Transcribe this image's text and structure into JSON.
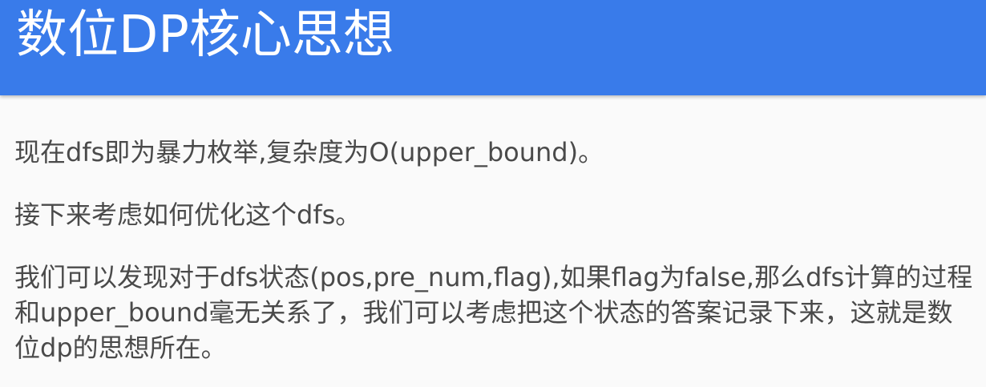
{
  "header": {
    "title": "数位DP核心思想",
    "background_color": "#397bea",
    "text_color": "#ffffff"
  },
  "content": {
    "text_color": "#4a4a4a",
    "paragraphs": [
      "现在dfs即为暴力枚举,复杂度为O(upper_bound)。",
      "接下来考虑如何优化这个dfs。",
      "我们可以发现对于dfs状态(pos,pre_num,flag),如果flag为false,那么dfs计算的过程和upper_bound毫无关系了，我们可以考虑把这个状态的答案记录下来，这就是数位dp的思想所在。"
    ]
  }
}
